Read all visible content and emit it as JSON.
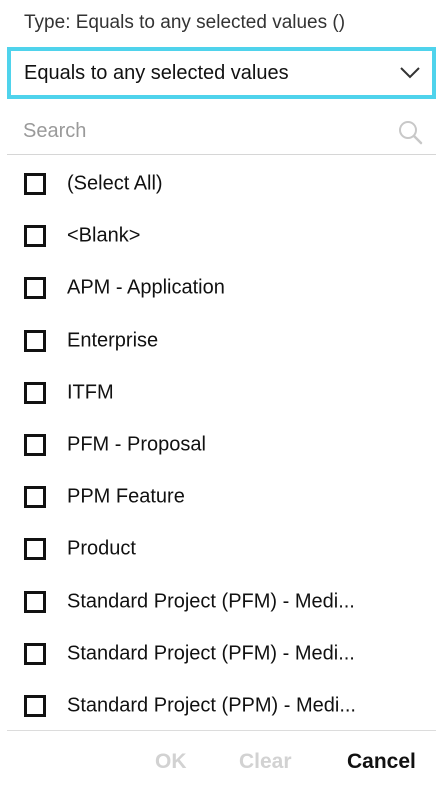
{
  "filter": {
    "type_label": "Type: Equals to any selected values ()",
    "select": {
      "value": "Equals to any selected values",
      "icon": "chevron-down-icon"
    },
    "search": {
      "placeholder": "Search",
      "value": "",
      "icon": "search-icon"
    },
    "items": [
      {
        "label": "(Select All)",
        "checked": false
      },
      {
        "label": "<Blank>",
        "checked": false
      },
      {
        "label": "APM - Application",
        "checked": false
      },
      {
        "label": "Enterprise",
        "checked": false
      },
      {
        "label": "ITFM",
        "checked": false
      },
      {
        "label": "PFM - Proposal",
        "checked": false
      },
      {
        "label": "PPM Feature",
        "checked": false
      },
      {
        "label": "Product",
        "checked": false
      },
      {
        "label": "Standard Project (PFM) - Medi...",
        "checked": false
      },
      {
        "label": "Standard Project (PFM) - Medi...",
        "checked": false
      },
      {
        "label": "Standard Project (PPM) - Medi...",
        "checked": false
      }
    ],
    "buttons": {
      "ok": "OK",
      "clear": "Clear",
      "cancel": "Cancel"
    }
  },
  "colors": {
    "focus_border": "#4fd3ec",
    "disabled_text": "#d2d2d2",
    "text": "#111111"
  }
}
